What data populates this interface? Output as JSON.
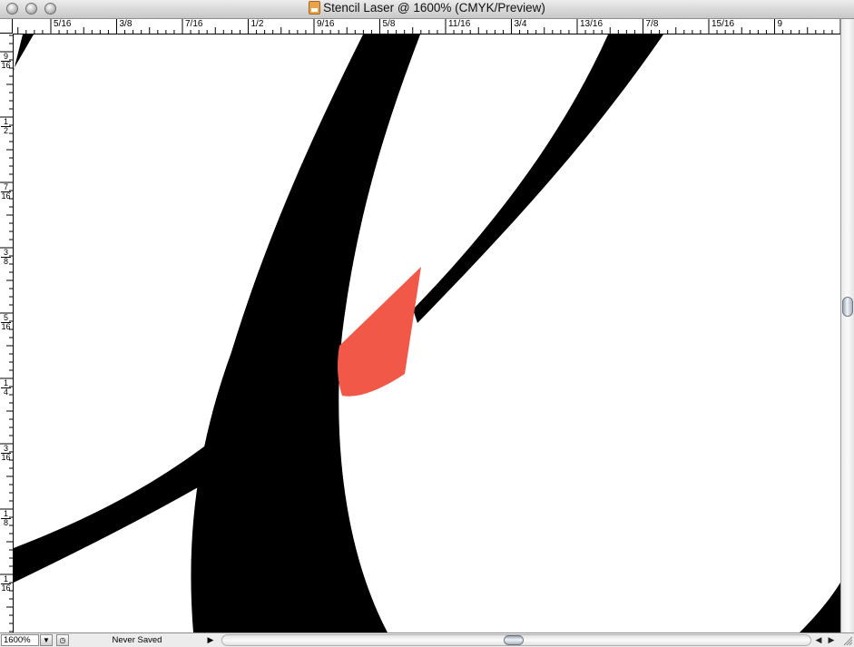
{
  "window": {
    "title": "Stencil Laser @ 1600% (CMYK/Preview)"
  },
  "ruler": {
    "horizontal_labels": [
      "5/16",
      "3/8",
      "7/16",
      "1/2",
      "9/16",
      "5/8",
      "11/16",
      "3/4",
      "13/16",
      "7/8",
      "15/16",
      "9",
      "1"
    ],
    "vertical_labels": [
      {
        "num": "9",
        "den": "16"
      },
      {
        "num": "1",
        "den": "2"
      },
      {
        "num": "7",
        "den": "16"
      },
      {
        "num": "3",
        "den": "8"
      },
      {
        "num": "5",
        "den": "16"
      },
      {
        "num": "1",
        "den": "4"
      },
      {
        "num": "3",
        "den": "16"
      },
      {
        "num": "1",
        "den": "8"
      },
      {
        "num": "1",
        "den": "16"
      }
    ]
  },
  "canvas": {
    "stroke_color": "#000000",
    "highlight_color": "#f15847",
    "background": "#ffffff"
  },
  "status": {
    "zoom": "1600%",
    "save_state": "Never Saved"
  },
  "icons": {
    "close": "close-button",
    "minimize": "minimize-button",
    "zoom": "zoom-button",
    "document": "document-icon"
  }
}
